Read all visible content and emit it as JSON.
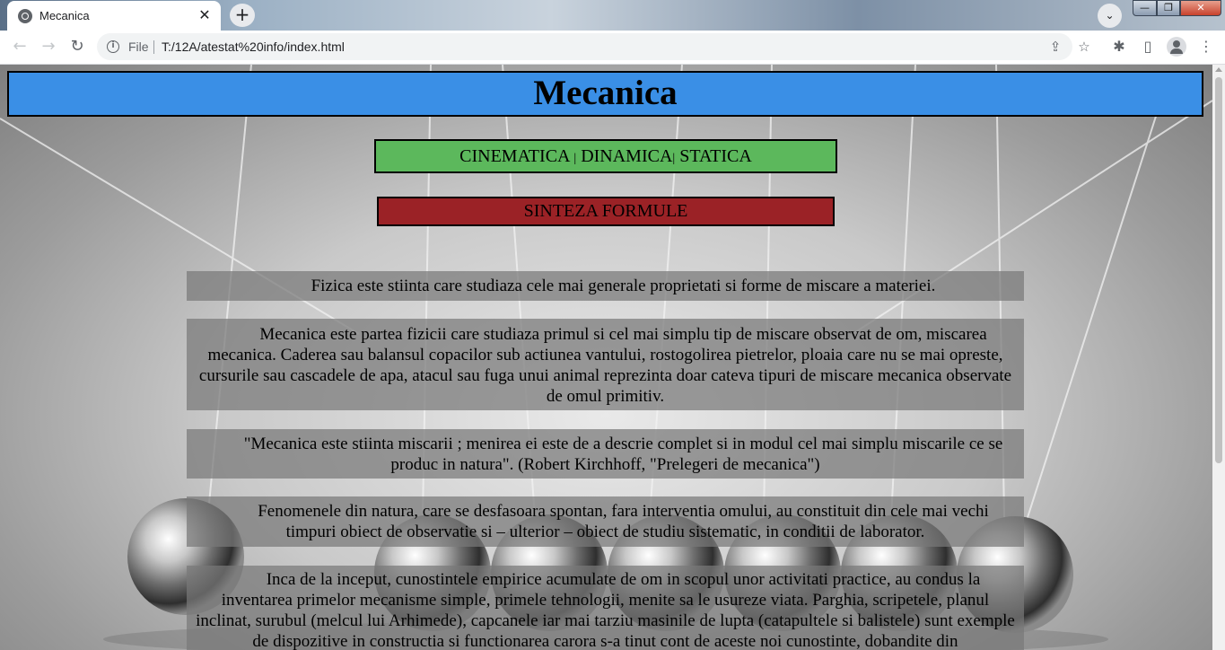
{
  "browser": {
    "tab_title": "Mecanica",
    "tab_close": "✕",
    "new_tab": "+",
    "tab_search": "⌄",
    "win_min": "—",
    "win_max": "❐",
    "win_close": "✕",
    "nav_back": "←",
    "nav_forward": "→",
    "nav_reload": "↻",
    "info_glyph": "i",
    "scheme_label": "File",
    "url": "T:/12A/atestat%20info/index.html",
    "share_glyph": "⇪",
    "star_glyph": "☆",
    "extensions_glyph": "✱",
    "panel_glyph": "▯",
    "menu_glyph": "⋮"
  },
  "page": {
    "title": "Mecanica",
    "nav": {
      "cinematica": "CINEMATICA",
      "sep1": "|",
      "dinamica": "DINAMICA",
      "sep2": "|",
      "statica": "STATICA"
    },
    "formule_link": "SINTEZA FORMULE",
    "paragraphs": [
      "Fizica este stiinta care studiaza cele mai generale proprietati si forme de miscare a materiei.",
      "Mecanica este partea fizicii care studiaza primul si cel mai simplu tip de miscare observat de om, miscarea mecanica. Caderea sau balansul copacilor sub actiunea vantului, rostogolirea pietrelor, ploaia care nu se mai opreste, cursurile sau cascadele de apa, atacul sau fuga unui animal reprezinta doar cateva tipuri de miscare mecanica observate de omul primitiv.",
      "\"Mecanica este stiinta miscarii ; menirea ei este de a descrie complet si in modul cel mai simplu miscarile ce se produc in natura\". (Robert Kirchhoff, \"Prelegeri de mecanica\")",
      "Fenomenele din natura, care se desfasoara spontan, fara interventia omului, au constituit din cele mai vechi timpuri obiect de observatie si – ulterior – obiect de studiu sistematic, in conditii de laborator.",
      "Inca de la inceput, cunostintele empirice acumulate de om in scopul unor activitati practice, au condus la inventarea primelor mecanisme simple, primele tehnologii, menite sa le usureze viata. Parghia, scripetele, planul inclinat, surubul (melcul lui Arhimede), capcanele iar mai tarziu masinile de lupta (catapultele si balistele) sunt exemple de dispozitive in constructia si functionarea carora s-a tinut cont de aceste noi cunostinte, dobandite din"
    ]
  },
  "colors": {
    "header_bg": "#3a8fe6",
    "nav_bg": "#5cb85c",
    "formule_bg": "#9b2226",
    "paragraph_bg": "rgba(120,120,120,0.72)"
  },
  "icons": [
    "globe-icon",
    "close-icon",
    "plus-icon",
    "chevron-down-icon",
    "back-arrow-icon",
    "forward-arrow-icon",
    "reload-icon",
    "info-icon",
    "share-icon",
    "star-icon",
    "puzzle-icon",
    "side-panel-icon",
    "profile-icon",
    "kebab-menu-icon"
  ]
}
